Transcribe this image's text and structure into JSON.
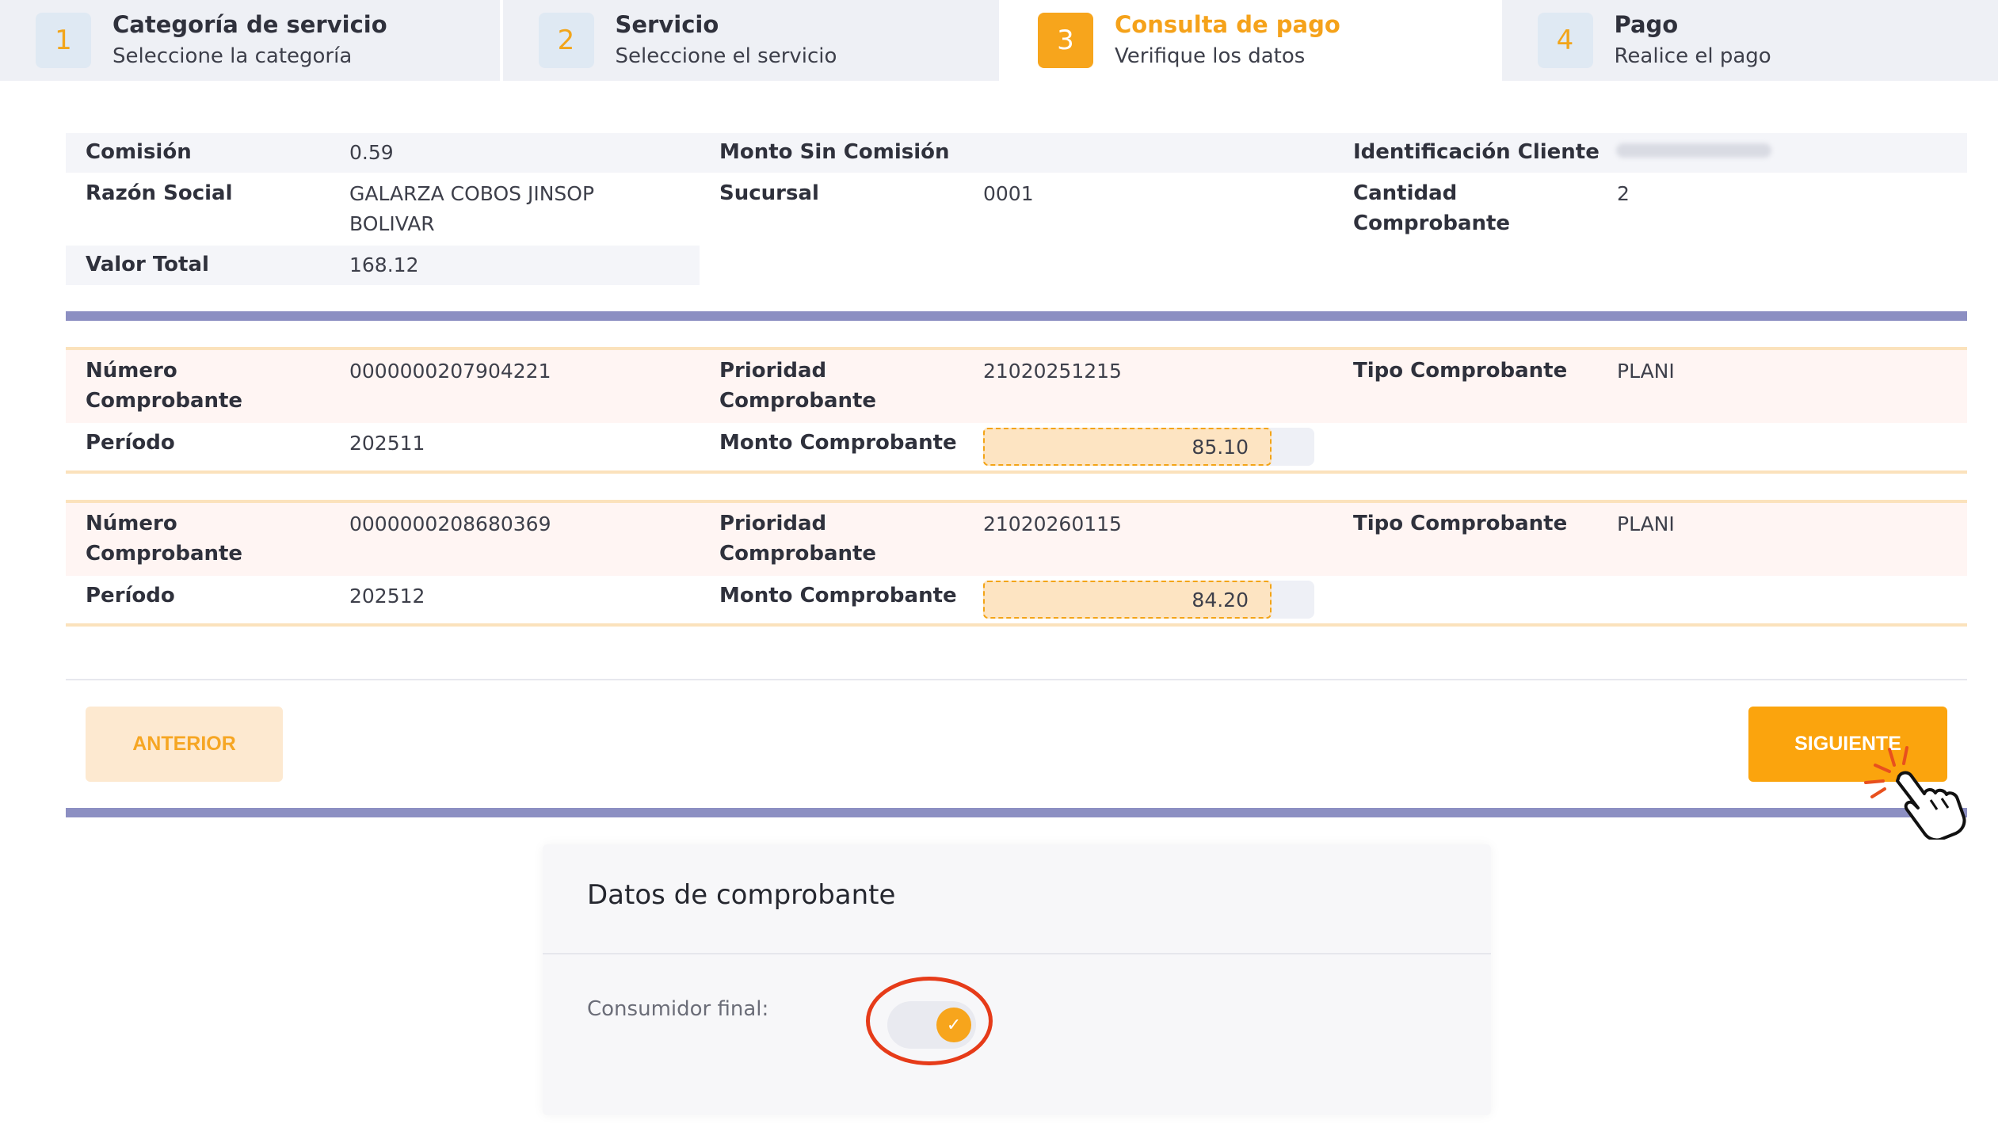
{
  "stepper": [
    {
      "num": "1",
      "title": "Categoría de servicio",
      "subtitle": "Seleccione la categoría",
      "active": false
    },
    {
      "num": "2",
      "title": "Servicio",
      "subtitle": "Seleccione el servicio",
      "active": false
    },
    {
      "num": "3",
      "title": "Consulta de pago",
      "subtitle": "Verifique los datos",
      "active": true
    },
    {
      "num": "4",
      "title": "Pago",
      "subtitle": "Realice el pago",
      "active": false
    }
  ],
  "summary": {
    "comision_label": "Comisión",
    "comision_value": "0.59",
    "monto_sin_comision_label": "Monto Sin Comisión",
    "identificacion_label": "Identificación Cliente",
    "razon_social_label": "Razón Social",
    "razon_social_value_line1": "GALARZA COBOS JINSOP",
    "razon_social_value_line2": "BOLIVAR",
    "sucursal_label": "Sucursal",
    "sucursal_value": "0001",
    "cantidad_label_line1": "Cantidad",
    "cantidad_label_line2": "Comprobante",
    "cantidad_value": "2",
    "valor_total_label": "Valor Total",
    "valor_total_value": "168.12"
  },
  "comprobantes": [
    {
      "numero_label_line1": "Número",
      "numero_label_line2": "Comprobante",
      "numero_value": "0000000207904221",
      "prioridad_label_line1": "Prioridad",
      "prioridad_label_line2": "Comprobante",
      "prioridad_value": "21020251215",
      "tipo_label": "Tipo Comprobante",
      "tipo_value": "PLANI",
      "periodo_label": "Período",
      "periodo_value": "202511",
      "monto_label": "Monto Comprobante",
      "monto_value": "85.10"
    },
    {
      "numero_label_line1": "Número",
      "numero_label_line2": "Comprobante",
      "numero_value": "0000000208680369",
      "prioridad_label_line1": "Prioridad",
      "prioridad_label_line2": "Comprobante",
      "prioridad_value": "21020260115",
      "tipo_label": "Tipo Comprobante",
      "tipo_value": "PLANI",
      "periodo_label": "Período",
      "periodo_value": "202512",
      "monto_label": "Monto Comprobante",
      "monto_value": "84.20"
    }
  ],
  "actions": {
    "prev_label": "ANTERIOR",
    "next_label": "SIGUIENTE"
  },
  "card": {
    "title": "Datos de comprobante",
    "consumidor_label": "Consumidor final:",
    "toggle_on": true,
    "check_glyph": "✓"
  },
  "colors": {
    "accent": "#f7a51c",
    "divider": "#8c8fc2",
    "highlight": "#e63b19"
  }
}
